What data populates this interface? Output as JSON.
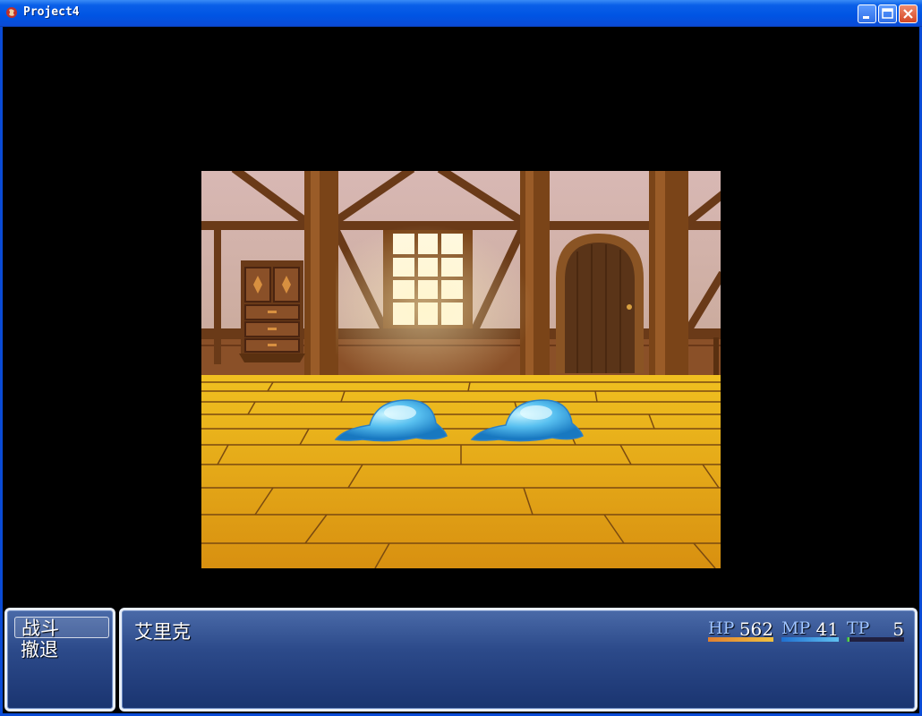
{
  "window": {
    "title": "Project4",
    "accent": "#0054e3"
  },
  "command_window": {
    "items": [
      {
        "label": "战斗",
        "selected": true
      },
      {
        "label": "撤退",
        "selected": false
      }
    ]
  },
  "status_window": {
    "actor_name": "艾里克",
    "hp": {
      "label": "HP",
      "value": "562",
      "fill": 1.0,
      "color_start": "#e08030",
      "color_end": "#f0c040"
    },
    "mp": {
      "label": "MP",
      "value": "41",
      "fill": 1.0,
      "color_start": "#2070d0",
      "color_end": "#60c0f0"
    },
    "tp": {
      "label": "TP",
      "value": "5",
      "fill": 0.05,
      "color_start": "#20a040",
      "color_end": "#80e060"
    }
  },
  "scene": {
    "enemies": [
      "slime",
      "slime"
    ],
    "background": "wooden-room"
  }
}
